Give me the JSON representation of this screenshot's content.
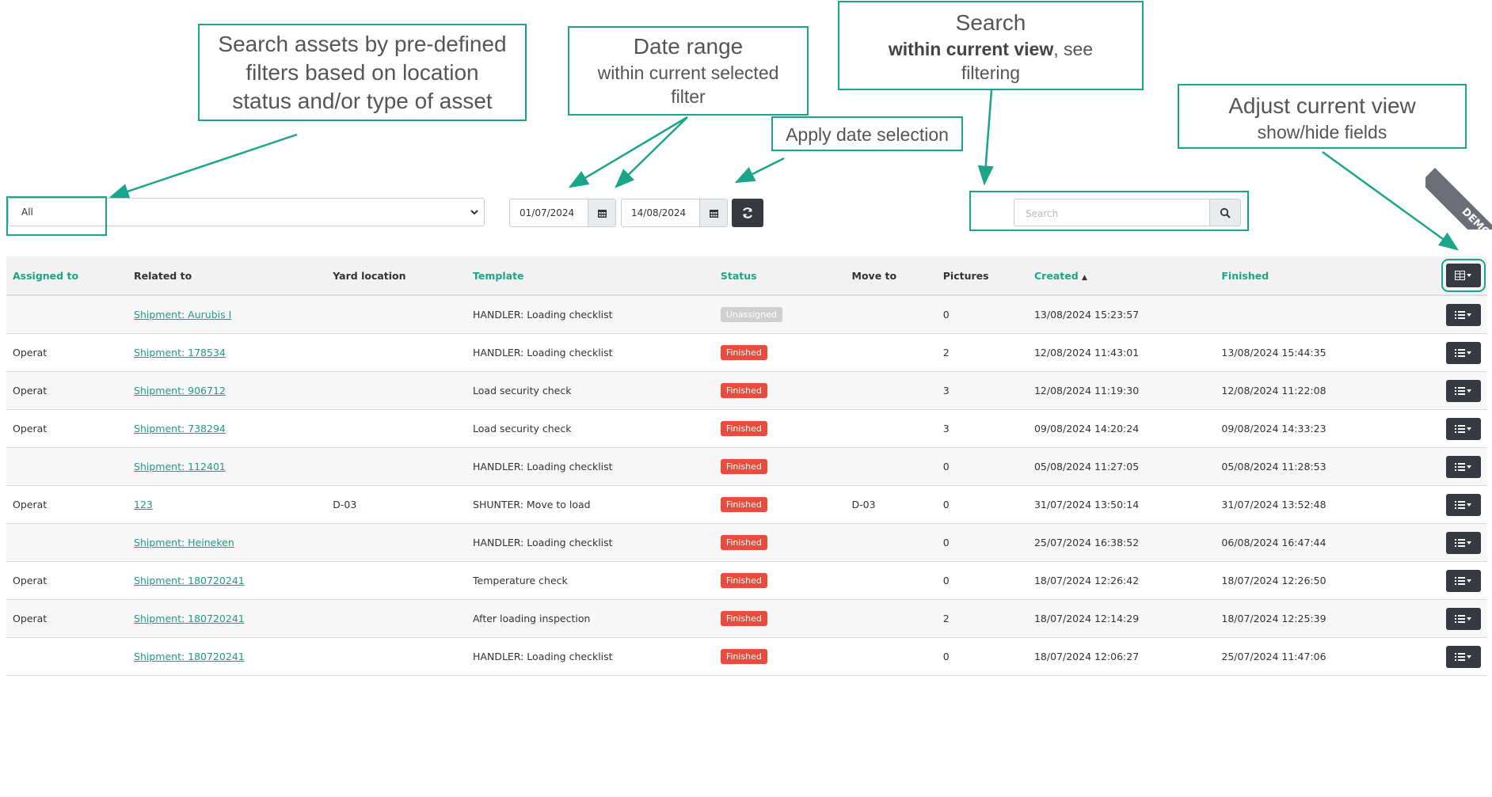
{
  "callouts": {
    "filters": "Search assets by pre-defined\nfilters based on location\nstatus and/or type of asset",
    "date_range_title": "Date range",
    "date_range_sub": "within current selected\nfilter",
    "apply": "Apply  date selection",
    "search_title": "Search",
    "search_bold": "within current view",
    "search_rest": ", see",
    "search_sub": "filtering",
    "adjust_title": "Adjust current view",
    "adjust_sub": "show/hide fields"
  },
  "toolbar": {
    "filter_value": "All",
    "date_from": "01/07/2024",
    "date_to": "14/08/2024",
    "search_placeholder": "Search",
    "demo_label": "DEMO"
  },
  "table": {
    "headers": {
      "assigned_to": "Assigned to",
      "related_to": "Related to",
      "yard_location": "Yard location",
      "template": "Template",
      "status": "Status",
      "move_to": "Move to",
      "pictures": "Pictures",
      "created": "Created",
      "finished": "Finished"
    },
    "sort_indicator": "▲",
    "rows": [
      {
        "assigned": "",
        "related": "Shipment: Aurubis I",
        "yard": "",
        "template": "HANDLER: Loading checklist",
        "status": "Unassigned",
        "move": "",
        "pictures": "0",
        "created": "13/08/2024 15:23:57",
        "finished": ""
      },
      {
        "assigned": "Operat",
        "related": "Shipment: 178534",
        "yard": "",
        "template": "HANDLER: Loading checklist",
        "status": "Finished",
        "move": "",
        "pictures": "2",
        "created": "12/08/2024 11:43:01",
        "finished": "13/08/2024 15:44:35"
      },
      {
        "assigned": "Operat",
        "related": "Shipment: 906712",
        "yard": "",
        "template": "Load security check",
        "status": "Finished",
        "move": "",
        "pictures": "3",
        "created": "12/08/2024 11:19:30",
        "finished": "12/08/2024 11:22:08"
      },
      {
        "assigned": "Operat",
        "related": "Shipment: 738294",
        "yard": "",
        "template": "Load security check",
        "status": "Finished",
        "move": "",
        "pictures": "3",
        "created": "09/08/2024 14:20:24",
        "finished": "09/08/2024 14:33:23"
      },
      {
        "assigned": "",
        "related": "Shipment: 112401",
        "yard": "",
        "template": "HANDLER: Loading checklist",
        "status": "Finished",
        "move": "",
        "pictures": "0",
        "created": "05/08/2024 11:27:05",
        "finished": "05/08/2024 11:28:53"
      },
      {
        "assigned": "Operat",
        "related": "123",
        "yard": "D-03",
        "template": "SHUNTER: Move to load",
        "status": "Finished",
        "move": "D-03",
        "pictures": "0",
        "created": "31/07/2024 13:50:14",
        "finished": "31/07/2024 13:52:48"
      },
      {
        "assigned": "",
        "related": "Shipment: Heineken",
        "yard": "",
        "template": "HANDLER: Loading checklist",
        "status": "Finished",
        "move": "",
        "pictures": "0",
        "created": "25/07/2024 16:38:52",
        "finished": "06/08/2024 16:47:44"
      },
      {
        "assigned": "Operat",
        "related": "Shipment: 180720241",
        "yard": "",
        "template": "Temperature check",
        "status": "Finished",
        "move": "",
        "pictures": "0",
        "created": "18/07/2024 12:26:42",
        "finished": "18/07/2024 12:26:50"
      },
      {
        "assigned": "Operat",
        "related": "Shipment: 180720241",
        "yard": "",
        "template": "After loading inspection",
        "status": "Finished",
        "move": "",
        "pictures": "2",
        "created": "18/07/2024 12:14:29",
        "finished": "18/07/2024 12:25:39"
      },
      {
        "assigned": "",
        "related": "Shipment: 180720241",
        "yard": "",
        "template": "HANDLER: Loading checklist",
        "status": "Finished",
        "move": "",
        "pictures": "0",
        "created": "18/07/2024 12:06:27",
        "finished": "25/07/2024 11:47:06"
      }
    ]
  },
  "colors": {
    "accent": "#1aa58a",
    "finished": "#e74c3c",
    "unassigned": "#d0d0d0",
    "dark_button": "#343a40"
  }
}
